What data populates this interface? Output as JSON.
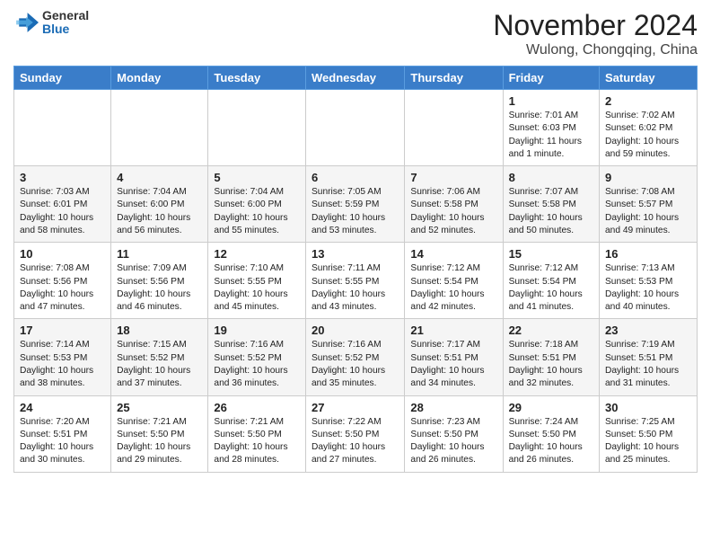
{
  "header": {
    "logo_line1": "General",
    "logo_line2": "Blue",
    "month": "November 2024",
    "location": "Wulong, Chongqing, China"
  },
  "weekdays": [
    "Sunday",
    "Monday",
    "Tuesday",
    "Wednesday",
    "Thursday",
    "Friday",
    "Saturday"
  ],
  "weeks": [
    [
      {
        "day": "",
        "info": ""
      },
      {
        "day": "",
        "info": ""
      },
      {
        "day": "",
        "info": ""
      },
      {
        "day": "",
        "info": ""
      },
      {
        "day": "",
        "info": ""
      },
      {
        "day": "1",
        "info": "Sunrise: 7:01 AM\nSunset: 6:03 PM\nDaylight: 11 hours and 1 minute."
      },
      {
        "day": "2",
        "info": "Sunrise: 7:02 AM\nSunset: 6:02 PM\nDaylight: 10 hours and 59 minutes."
      }
    ],
    [
      {
        "day": "3",
        "info": "Sunrise: 7:03 AM\nSunset: 6:01 PM\nDaylight: 10 hours and 58 minutes."
      },
      {
        "day": "4",
        "info": "Sunrise: 7:04 AM\nSunset: 6:00 PM\nDaylight: 10 hours and 56 minutes."
      },
      {
        "day": "5",
        "info": "Sunrise: 7:04 AM\nSunset: 6:00 PM\nDaylight: 10 hours and 55 minutes."
      },
      {
        "day": "6",
        "info": "Sunrise: 7:05 AM\nSunset: 5:59 PM\nDaylight: 10 hours and 53 minutes."
      },
      {
        "day": "7",
        "info": "Sunrise: 7:06 AM\nSunset: 5:58 PM\nDaylight: 10 hours and 52 minutes."
      },
      {
        "day": "8",
        "info": "Sunrise: 7:07 AM\nSunset: 5:58 PM\nDaylight: 10 hours and 50 minutes."
      },
      {
        "day": "9",
        "info": "Sunrise: 7:08 AM\nSunset: 5:57 PM\nDaylight: 10 hours and 49 minutes."
      }
    ],
    [
      {
        "day": "10",
        "info": "Sunrise: 7:08 AM\nSunset: 5:56 PM\nDaylight: 10 hours and 47 minutes."
      },
      {
        "day": "11",
        "info": "Sunrise: 7:09 AM\nSunset: 5:56 PM\nDaylight: 10 hours and 46 minutes."
      },
      {
        "day": "12",
        "info": "Sunrise: 7:10 AM\nSunset: 5:55 PM\nDaylight: 10 hours and 45 minutes."
      },
      {
        "day": "13",
        "info": "Sunrise: 7:11 AM\nSunset: 5:55 PM\nDaylight: 10 hours and 43 minutes."
      },
      {
        "day": "14",
        "info": "Sunrise: 7:12 AM\nSunset: 5:54 PM\nDaylight: 10 hours and 42 minutes."
      },
      {
        "day": "15",
        "info": "Sunrise: 7:12 AM\nSunset: 5:54 PM\nDaylight: 10 hours and 41 minutes."
      },
      {
        "day": "16",
        "info": "Sunrise: 7:13 AM\nSunset: 5:53 PM\nDaylight: 10 hours and 40 minutes."
      }
    ],
    [
      {
        "day": "17",
        "info": "Sunrise: 7:14 AM\nSunset: 5:53 PM\nDaylight: 10 hours and 38 minutes."
      },
      {
        "day": "18",
        "info": "Sunrise: 7:15 AM\nSunset: 5:52 PM\nDaylight: 10 hours and 37 minutes."
      },
      {
        "day": "19",
        "info": "Sunrise: 7:16 AM\nSunset: 5:52 PM\nDaylight: 10 hours and 36 minutes."
      },
      {
        "day": "20",
        "info": "Sunrise: 7:16 AM\nSunset: 5:52 PM\nDaylight: 10 hours and 35 minutes."
      },
      {
        "day": "21",
        "info": "Sunrise: 7:17 AM\nSunset: 5:51 PM\nDaylight: 10 hours and 34 minutes."
      },
      {
        "day": "22",
        "info": "Sunrise: 7:18 AM\nSunset: 5:51 PM\nDaylight: 10 hours and 32 minutes."
      },
      {
        "day": "23",
        "info": "Sunrise: 7:19 AM\nSunset: 5:51 PM\nDaylight: 10 hours and 31 minutes."
      }
    ],
    [
      {
        "day": "24",
        "info": "Sunrise: 7:20 AM\nSunset: 5:51 PM\nDaylight: 10 hours and 30 minutes."
      },
      {
        "day": "25",
        "info": "Sunrise: 7:21 AM\nSunset: 5:50 PM\nDaylight: 10 hours and 29 minutes."
      },
      {
        "day": "26",
        "info": "Sunrise: 7:21 AM\nSunset: 5:50 PM\nDaylight: 10 hours and 28 minutes."
      },
      {
        "day": "27",
        "info": "Sunrise: 7:22 AM\nSunset: 5:50 PM\nDaylight: 10 hours and 27 minutes."
      },
      {
        "day": "28",
        "info": "Sunrise: 7:23 AM\nSunset: 5:50 PM\nDaylight: 10 hours and 26 minutes."
      },
      {
        "day": "29",
        "info": "Sunrise: 7:24 AM\nSunset: 5:50 PM\nDaylight: 10 hours and 26 minutes."
      },
      {
        "day": "30",
        "info": "Sunrise: 7:25 AM\nSunset: 5:50 PM\nDaylight: 10 hours and 25 minutes."
      }
    ]
  ]
}
